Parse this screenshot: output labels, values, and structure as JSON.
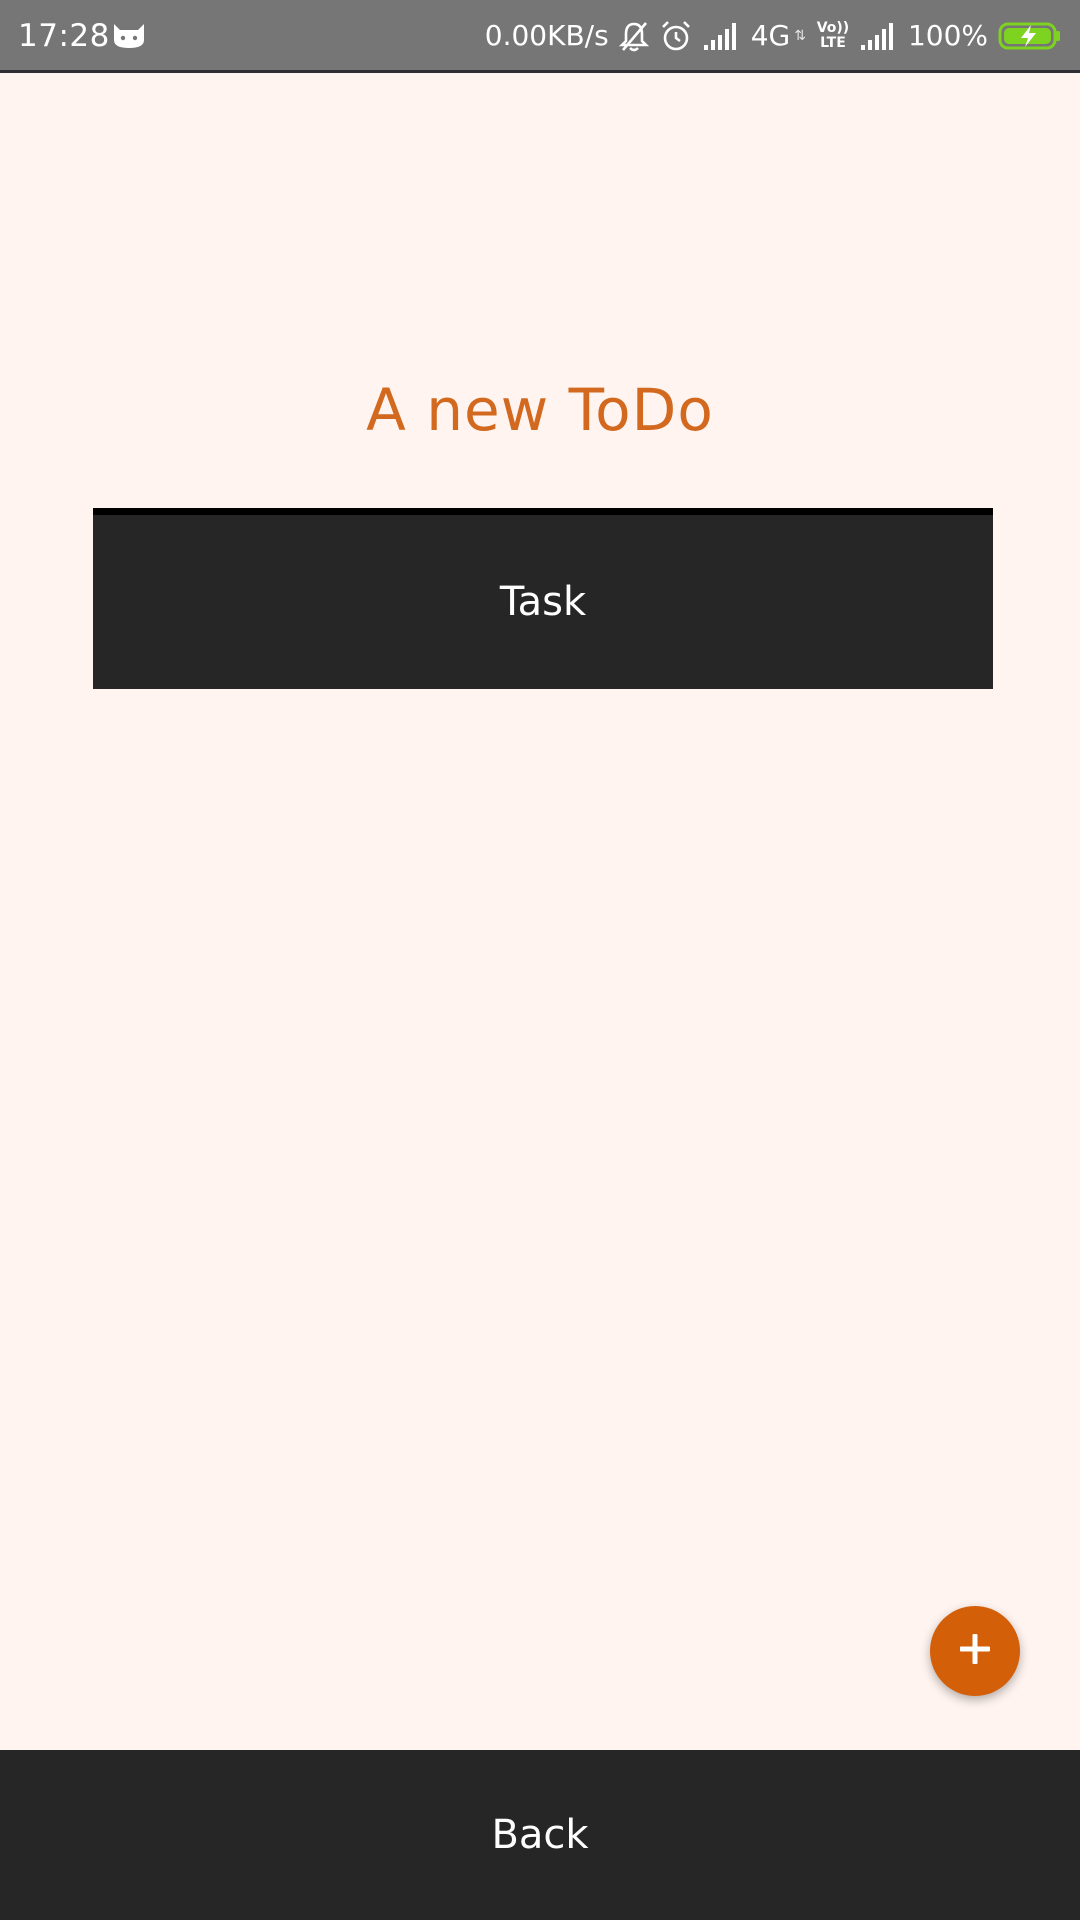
{
  "status_bar": {
    "time": "17:28",
    "left_icon": "cat-notification-icon",
    "net_speed": "0.00KB/s",
    "icons": [
      "bell-off-icon",
      "alarm-icon",
      "signal-icon",
      "signal-icon"
    ],
    "network_type": "4G",
    "volte_top": "Vo))",
    "volte_bottom": "LTE",
    "battery": "100%",
    "battery_color": "#7ED321"
  },
  "main": {
    "title": "A new ToDo",
    "title_color": "#D2691E",
    "task_placeholder": "Task",
    "fab_icon": "plus-icon",
    "fab_color": "#D35F08"
  },
  "footer": {
    "back_label": "Back"
  }
}
